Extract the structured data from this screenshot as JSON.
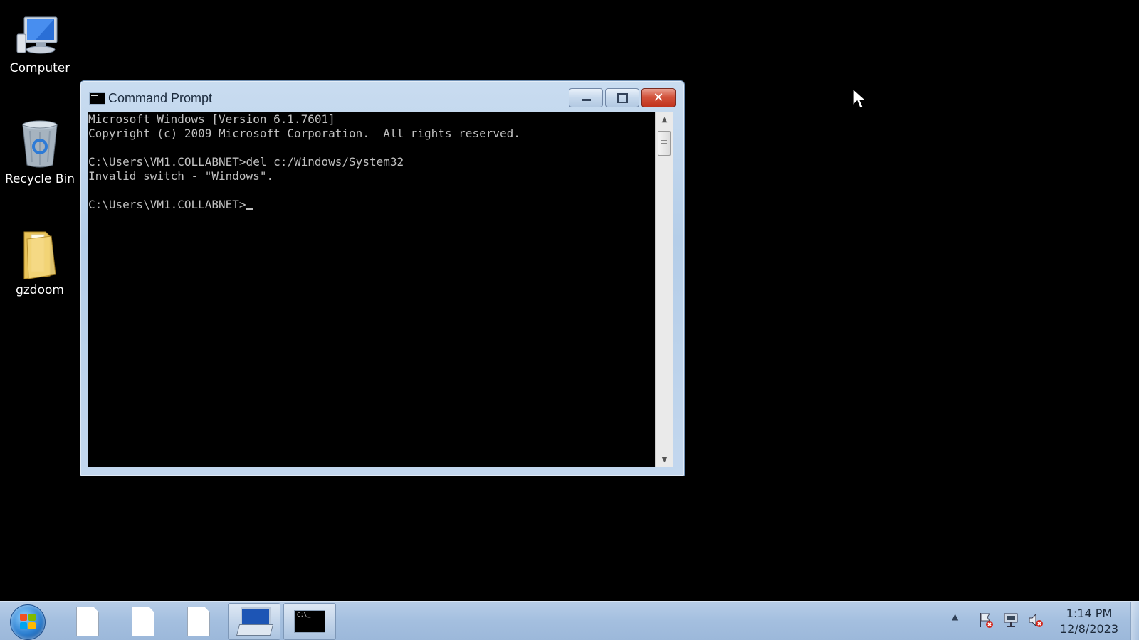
{
  "desktop": {
    "icons": [
      {
        "label": "Computer",
        "icon": "computer-icon"
      },
      {
        "label": "Recycle Bin",
        "icon": "recycle-bin-icon"
      },
      {
        "label": "gzdoom",
        "icon": "folder-icon"
      }
    ]
  },
  "window": {
    "title": "Command Prompt",
    "buttons": {
      "minimize": "minimize",
      "maximize": "maximize",
      "close": "close"
    },
    "console_lines": [
      "Microsoft Windows [Version 6.1.7601]",
      "Copyright (c) 2009 Microsoft Corporation.  All rights reserved.",
      "",
      "C:\\Users\\VM1.COLLABNET>del c:/Windows/System32",
      "Invalid switch - \"Windows\".",
      "",
      "C:\\Users\\VM1.COLLABNET>"
    ]
  },
  "taskbar": {
    "start": "start-orb-icon",
    "items": [
      {
        "icon": "document-icon",
        "active": false
      },
      {
        "icon": "document-icon",
        "active": false
      },
      {
        "icon": "document-icon",
        "active": false
      },
      {
        "icon": "on-screen-keyboard-icon",
        "active": true
      },
      {
        "icon": "command-prompt-icon",
        "active": true
      }
    ],
    "tray": {
      "icons": [
        "show-hidden-icons-arrow",
        "action-center-flag-icon",
        "network-icon",
        "volume-muted-icon"
      ],
      "time": "1:14 PM",
      "date": "12/8/2023"
    }
  }
}
